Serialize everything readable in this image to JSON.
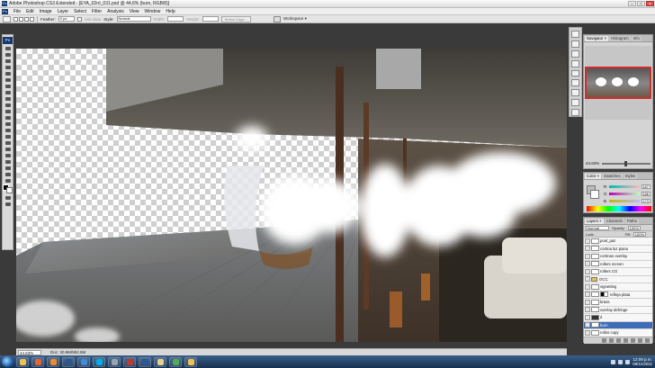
{
  "window": {
    "title": "Adobe Photoshop CS3 Extended - [EYA_02rrl_031.psd @ 44,6% (burn, RGB/8)]",
    "app_badge": "Ps",
    "controls": [
      "–",
      "□",
      "×"
    ]
  },
  "menu": [
    "File",
    "Edit",
    "Image",
    "Layer",
    "Select",
    "Filter",
    "Analysis",
    "View",
    "Window",
    "Help"
  ],
  "options": {
    "feather_label": "Feather:",
    "feather_value": "0 px",
    "antialias_label": "Anti-alias",
    "style_label": "Style:",
    "style_value": "Normal",
    "width_label": "Width:",
    "height_label": "Height:",
    "refine_edge": "Refine Edge...",
    "workspace": "Workspace ▾"
  },
  "toolbox": {
    "logo": "Ps"
  },
  "status": {
    "zoom": "44.63%",
    "doc_info": "Doc: 30.9M/962.5M"
  },
  "navigator": {
    "tabs": [
      "Navigator ×",
      "Histogram",
      "Info"
    ],
    "zoom": "44.63%"
  },
  "color": {
    "tabs": [
      "Color ×",
      "Swatches",
      "Styles"
    ],
    "channels": [
      {
        "label": "R",
        "value": "187"
      },
      {
        "label": "G",
        "value": "186"
      },
      {
        "label": "B",
        "value": "173"
      }
    ]
  },
  "layers": {
    "tabs": [
      "Layers ×",
      "Channels",
      "Paths"
    ],
    "blend_mode": "Normal",
    "opacity_label": "Opacity:",
    "opacity_value": "100%",
    "lock_label": "Lock:",
    "fill_label": "Fill:",
    "fill_value": "100%",
    "items": [
      {
        "name": "pool_paz",
        "type": "layer"
      },
      {
        "name": "cortina luz piano",
        "type": "layer"
      },
      {
        "name": "cortinas overlay",
        "type": "layer"
      },
      {
        "name": "rollers screen",
        "type": "layer"
      },
      {
        "name": "rollers CO",
        "type": "layer"
      },
      {
        "name": "OCC",
        "type": "folder"
      },
      {
        "name": "vignetting",
        "type": "layer"
      },
      {
        "name": "refleja plata",
        "type": "mask"
      },
      {
        "name": "brass",
        "type": "layer"
      },
      {
        "name": "overlay defringe",
        "type": "layer"
      },
      {
        "name": "d",
        "type": "dark"
      },
      {
        "name": "burn",
        "type": "layer",
        "selected": true
      },
      {
        "name": "rollos copy",
        "type": "layer"
      }
    ]
  },
  "taskbar": {
    "clock_time": "12:09 p.m.",
    "clock_date": "08/11/2011",
    "apps": [
      {
        "name": "explorer-icon",
        "color": "#f2c14e"
      },
      {
        "name": "firefox-icon",
        "color": "#e8662c"
      },
      {
        "name": "media-icon",
        "color": "#f08a24"
      },
      {
        "name": "photoshop-icon",
        "color": "#2b5797"
      },
      {
        "name": "explorer2-icon",
        "color": "#3c8dde"
      },
      {
        "name": "skype-icon",
        "color": "#00aff0"
      },
      {
        "name": "disk-icon",
        "color": "#9aa5b1"
      },
      {
        "name": "pdf-icon",
        "color": "#c0392b"
      },
      {
        "name": "photoshop2-icon",
        "color": "#2b5797"
      },
      {
        "name": "paint-icon",
        "color": "#e5d38a"
      },
      {
        "name": "network-icon",
        "color": "#4caf50"
      },
      {
        "name": "folder-icon",
        "color": "#f2c14e"
      }
    ]
  }
}
